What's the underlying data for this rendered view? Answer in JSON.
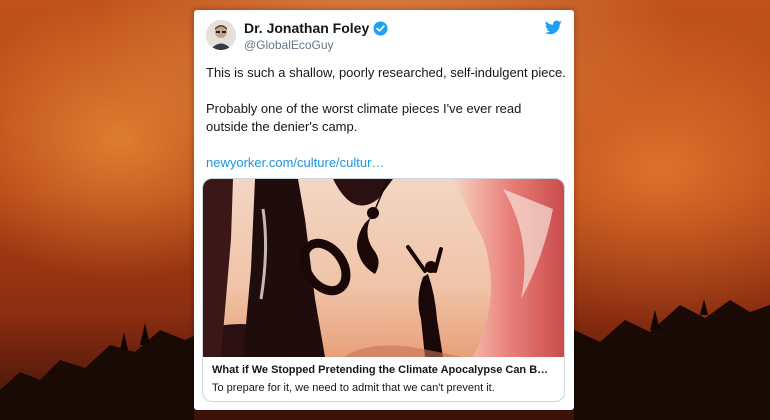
{
  "tweet": {
    "author_name": "Dr. Jonathan Foley",
    "author_handle": "@GlobalEcoGuy",
    "paragraph_1": "This is such a shallow, poorly researched, self-indulgent piece.",
    "paragraph_2": "Probably one of the worst climate pieces I've ever read outside the denier's camp.",
    "link_text": "newyorker.com/culture/cultur…",
    "icons": {
      "avatar": "author-avatar",
      "verified": "verified-badge-icon",
      "platform": "twitter-bird-icon"
    },
    "colors": {
      "link": "#1b95e0",
      "verified": "#1da1f2",
      "handle": "#657786"
    }
  },
  "card": {
    "title": "What if We Stopped Pretending the Climate Apocalypse Can B…",
    "description": "To prepare for it, we need to admit that we can't prevent it."
  }
}
